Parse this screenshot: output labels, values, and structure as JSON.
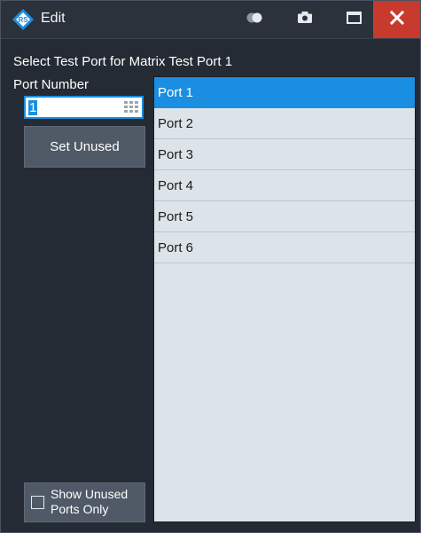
{
  "window": {
    "title": "Edit",
    "accent_color": "#1a8ee0",
    "close_color": "#c8392e"
  },
  "titlebar": {
    "icons": [
      "rs-logo-icon",
      "toggle-icon",
      "camera-icon",
      "maximize-icon",
      "close-icon"
    ]
  },
  "dialog": {
    "prompt": "Select Test Port for Matrix Test Port 1",
    "port_number_label": "Port Number",
    "port_number_value": "1",
    "set_unused_label": "Set Unused",
    "show_unused_label_line1": "Show Unused",
    "show_unused_label_line2": "Ports Only",
    "show_unused_checked": false
  },
  "ports": {
    "selected_index": 0,
    "items": [
      "Port 1",
      "Port 2",
      "Port 3",
      "Port 4",
      "Port 5",
      "Port 6"
    ]
  }
}
